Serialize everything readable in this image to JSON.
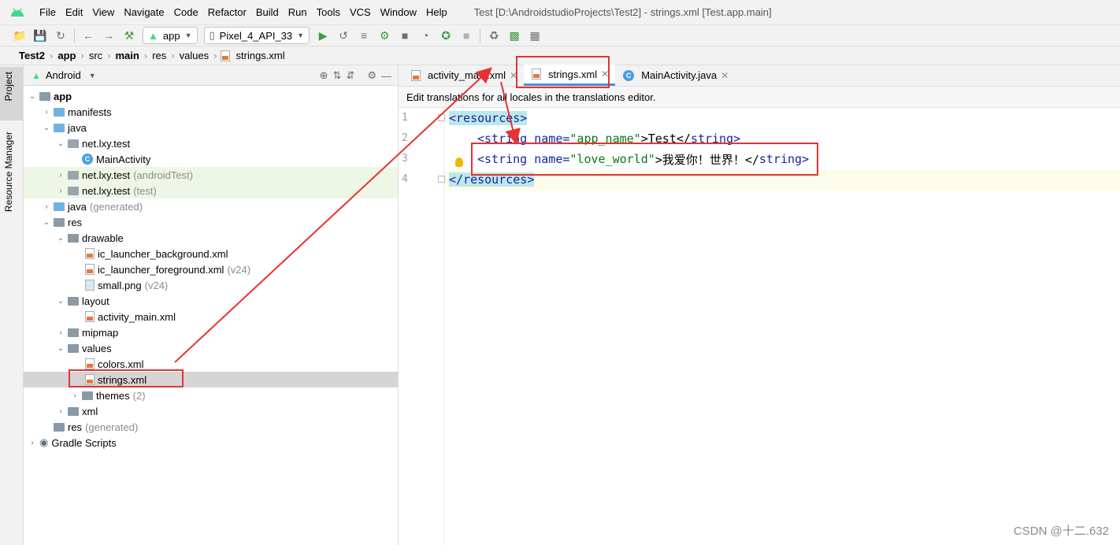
{
  "menubar": {
    "items": [
      "File",
      "Edit",
      "View",
      "Navigate",
      "Code",
      "Refactor",
      "Build",
      "Run",
      "Tools",
      "VCS",
      "Window",
      "Help"
    ],
    "window_title": "Test [D:\\AndroidstudioProjects\\Test2] - strings.xml [Test.app.main]"
  },
  "toolbar": {
    "config": "app",
    "device": "Pixel_4_API_33"
  },
  "breadcrumb": [
    "Test2",
    "app",
    "src",
    "main",
    "res",
    "values",
    "strings.xml"
  ],
  "left_strip": {
    "project_tab": "Project",
    "resource_tab": "Resource Manager"
  },
  "project": {
    "view": "Android",
    "tree": [
      {
        "label": "app",
        "suffix": ""
      },
      {
        "label": "manifests",
        "suffix": ""
      },
      {
        "label": "java",
        "suffix": ""
      },
      {
        "label": "net.lxy.test",
        "suffix": ""
      },
      {
        "label": "MainActivity",
        "suffix": ""
      },
      {
        "label": "net.lxy.test",
        "suffix": "(androidTest)"
      },
      {
        "label": "net.lxy.test",
        "suffix": "(test)"
      },
      {
        "label": "java",
        "suffix": "(generated)"
      },
      {
        "label": "res",
        "suffix": ""
      },
      {
        "label": "drawable",
        "suffix": ""
      },
      {
        "label": "ic_launcher_background.xml",
        "suffix": ""
      },
      {
        "label": "ic_launcher_foreground.xml",
        "suffix": "(v24)"
      },
      {
        "label": "small.png",
        "suffix": "(v24)"
      },
      {
        "label": "layout",
        "suffix": ""
      },
      {
        "label": "activity_main.xml",
        "suffix": ""
      },
      {
        "label": "mipmap",
        "suffix": ""
      },
      {
        "label": "values",
        "suffix": ""
      },
      {
        "label": "colors.xml",
        "suffix": ""
      },
      {
        "label": "strings.xml",
        "suffix": ""
      },
      {
        "label": "themes",
        "suffix": "(2)"
      },
      {
        "label": "xml",
        "suffix": ""
      },
      {
        "label": "res",
        "suffix": "(generated)"
      },
      {
        "label": "Gradle Scripts",
        "suffix": ""
      }
    ]
  },
  "editor": {
    "tabs": [
      "activity_main.xml",
      "strings.xml",
      "MainActivity.java"
    ],
    "notice": "Edit translations for all locales in the translations editor.",
    "line_numbers": [
      "1",
      "2",
      "3",
      "4"
    ],
    "lines": {
      "l1_tag": "<resources>",
      "l2_open": "<string",
      "l2_attr": " name=",
      "l2_val": "\"app_name\"",
      "l2_text": ">Test</",
      "l2_close": "string>",
      "l3_open": "<string",
      "l3_attr": " name=",
      "l3_val": "\"love_world\"",
      "l3_text": ">我爱你！世界！</",
      "l3_close": "string>",
      "l4_tag": "</resources>"
    }
  },
  "watermark": "CSDN @十二.632",
  "colors": {
    "annotation_red": "#e53333",
    "tab_accent": "#4a8ee0"
  }
}
